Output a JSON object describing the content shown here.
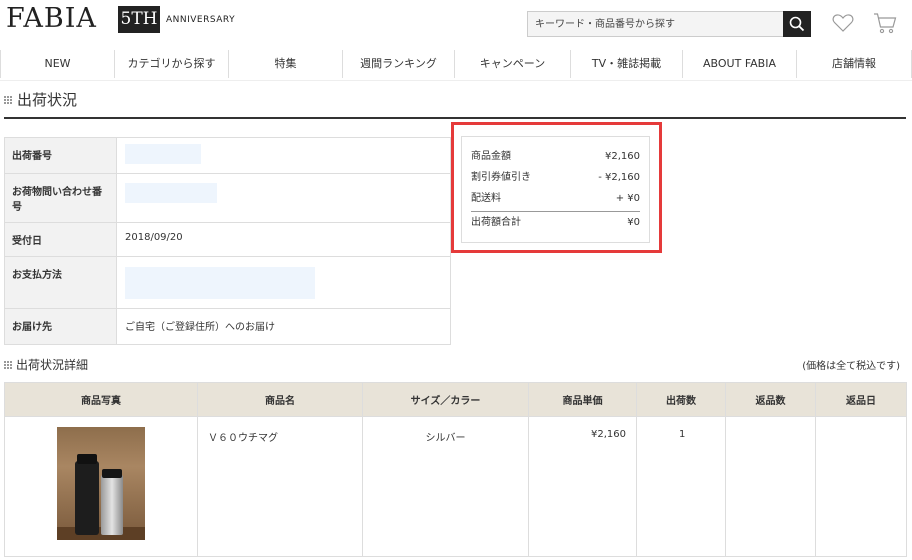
{
  "header": {
    "logo": "FABIA",
    "anniversary_badge": "5TH",
    "anniversary_text": "ANNIVERSARY",
    "search_placeholder": "キーワード・商品番号から探す",
    "icons": [
      "search-icon",
      "heart-icon",
      "cart-icon"
    ]
  },
  "nav": {
    "items": [
      "NEW",
      "カテゴリから探す",
      "特集",
      "週間ランキング",
      "キャンペーン",
      "TV・雑誌掲載",
      "ABOUT FABIA",
      "店舗情報"
    ]
  },
  "page": {
    "title": "出荷状況"
  },
  "info": {
    "rows": [
      {
        "label": "出荷番号",
        "value": ""
      },
      {
        "label": "お荷物問い合わせ番号",
        "value": ""
      },
      {
        "label": "受付日",
        "value": "2018/09/20"
      },
      {
        "label": "お支払方法",
        "value": ""
      },
      {
        "label": "お届け先",
        "value": "ご自宅（ご登録住所）へのお届け"
      }
    ]
  },
  "summary": {
    "rows": [
      {
        "label": "商品金額",
        "value": "¥2,160"
      },
      {
        "label": "割引券値引き",
        "value": "- ¥2,160"
      },
      {
        "label": "配送料",
        "value": "+ ¥0"
      }
    ],
    "total_label": "出荷額合計",
    "total_value": "¥0"
  },
  "detail": {
    "title": "出荷状況詳細",
    "note": "(価格は全て税込です)",
    "columns": [
      "商品写真",
      "商品名",
      "サイズ／カラー",
      "商品単価",
      "出荷数",
      "返品数",
      "返品日"
    ],
    "rows": [
      {
        "name": "Ｖ６０ウチマグ",
        "size_color": "シルバー",
        "unit_price": "¥2,160",
        "qty": "1",
        "returns": "",
        "return_date": ""
      }
    ]
  },
  "colors": {
    "highlight": "#e53a3a",
    "header_bg": "#e8e3d8",
    "label_bg": "#f2f2f2"
  }
}
